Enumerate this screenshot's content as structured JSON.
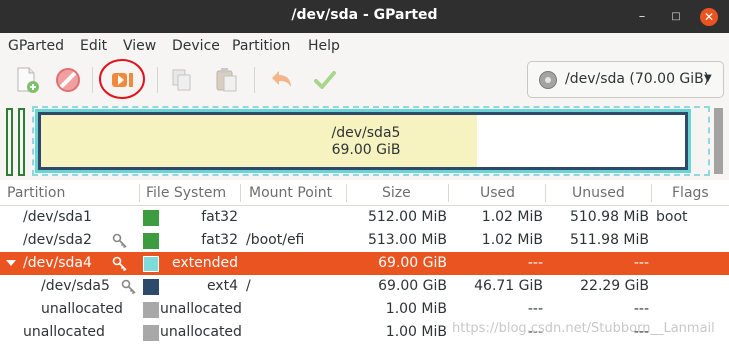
{
  "window": {
    "title": "/dev/sda - GParted",
    "minimize": "–",
    "maximize": "□",
    "close": "✕"
  },
  "menu": [
    "GParted",
    "Edit",
    "View",
    "Device",
    "Partition",
    "Help"
  ],
  "toolbar": {
    "buttons": [
      "new-partition-icon",
      "delete-icon",
      "resize-move-icon",
      "copy-icon",
      "paste-icon",
      "undo-icon",
      "apply-icon"
    ],
    "annotation_color": "#e0141c",
    "device": "/dev/sda (70.00 GiB)"
  },
  "diskmap": {
    "partition_name": "/dev/sda5",
    "partition_size": "69.00 GiB",
    "used_fraction": 0.677
  },
  "table": {
    "columns": [
      "Partition",
      "File System",
      "Mount Point",
      "Size",
      "Used",
      "Unused",
      "Flags"
    ],
    "rows": [
      {
        "partition": "/dev/sda1",
        "key": false,
        "fs_color": "#3d9c3d",
        "fs": "fat32",
        "mount": "",
        "size": "512.00 MiB",
        "used": "1.02 MiB",
        "unused": "510.98 MiB",
        "flags": "boot"
      },
      {
        "partition": "/dev/sda2",
        "key": true,
        "fs_color": "#3d9c3d",
        "fs": "fat32",
        "mount": "/boot/efi",
        "size": "513.00 MiB",
        "used": "1.02 MiB",
        "unused": "511.98 MiB",
        "flags": ""
      },
      {
        "partition": "/dev/sda4",
        "key": true,
        "fs_color": "#7fdada",
        "fs": "extended",
        "mount": "",
        "size": "69.00 GiB",
        "used": "---",
        "unused": "---",
        "flags": ""
      },
      {
        "partition": "/dev/sda5",
        "key": true,
        "fs_color": "#2d4a6b",
        "fs": "ext4",
        "mount": "/",
        "size": "69.00 GiB",
        "used": "46.71 GiB",
        "unused": "22.29 GiB",
        "flags": ""
      },
      {
        "partition": "unallocated",
        "key": false,
        "fs_color": "#a8a8a8",
        "fs": "unallocated",
        "mount": "",
        "size": "1.00 MiB",
        "used": "---",
        "unused": "---",
        "flags": ""
      },
      {
        "partition": "unallocated",
        "key": false,
        "fs_color": "#a8a8a8",
        "fs": "unallocated",
        "mount": "",
        "size": "1.00 MiB",
        "used": "---",
        "unused": "---",
        "flags": ""
      }
    ],
    "selected_row": 2,
    "watermark": "https://blog.csdn.net/Stubborn__Lanmail"
  }
}
